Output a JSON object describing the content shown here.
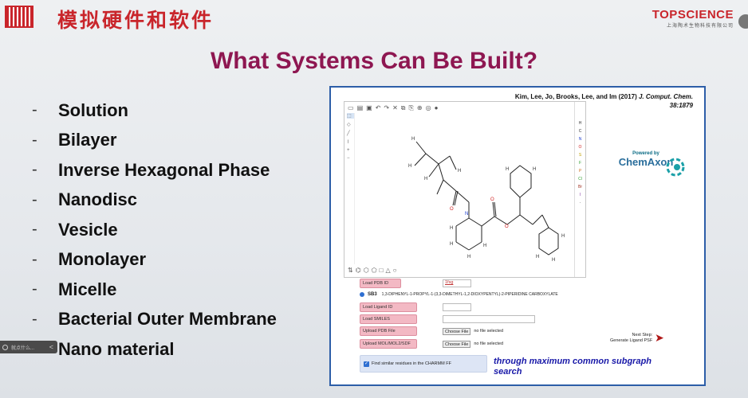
{
  "header": {
    "cn_title": "模拟硬件和软件",
    "brand_name": "TOPSCIENCE",
    "brand_sub": "上海陶术生物科技有限公司"
  },
  "main_title": "What Systems Can Be Built?",
  "systems": [
    "Solution",
    "Bilayer",
    "Inverse Hexagonal Phase",
    "Nanodisc",
    "Vesicle",
    "Monolayer",
    "Micelle",
    "Bacterial Outer Membrane",
    "Nano material"
  ],
  "bullet": "-",
  "side_pill": {
    "text": "就点什么...",
    "arrow": "<"
  },
  "screenshot": {
    "citation_line1": "Kim, Lee, Jo, Brooks, Lee, and Im (2017)",
    "citation_journal": "J. Comput. Chem.",
    "citation_line2": "38:1879",
    "powered_by": "Powered by",
    "chemaxon": "ChemAxon",
    "element_symbols": [
      "H",
      "C",
      "N",
      "O",
      "S",
      "F",
      "P",
      "Cl",
      "Br",
      "I",
      "·"
    ],
    "form": {
      "load_pdb_id": "Load PDB ID",
      "pdb_value": "1fsg",
      "sb3_label": "SB3",
      "sb3_name": "1,3-DIPHENYL-1-PROPYL-1-(3,3-DIMETHYL-1,2-DIOXYPENTYL)-2-PIPERIDINE CARBOXYLATE",
      "load_ligand_id": "Load Ligand ID",
      "load_smiles": "Load SMILES",
      "upload_pdb": "Upload PDB File",
      "upload_mol": "Upload MOL/MOL2/SDF",
      "choose_file": "Choose File",
      "no_file": "no file selected",
      "next_step_line1": "Next Step:",
      "next_step_line2": "Generate Ligand PSF",
      "find_similar": "Find similar residues in the CHARMM FF",
      "mcs_note": "through maximum common subgraph search"
    }
  }
}
